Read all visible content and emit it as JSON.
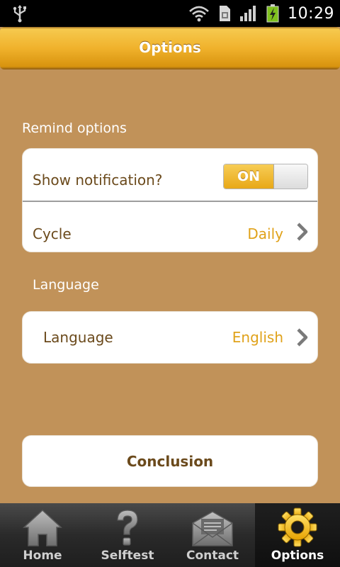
{
  "status_bar": {
    "time": "10:29",
    "icons": [
      "usb-icon",
      "wifi-icon",
      "sim-icon",
      "signal-icon",
      "battery-charging-icon"
    ]
  },
  "header": {
    "title": "Options"
  },
  "remind_section": {
    "label": "Remind options",
    "notification": {
      "label": "Show notification?",
      "toggle_label": "ON",
      "state": "on"
    },
    "cycle": {
      "label": "Cycle",
      "value": "Daily"
    }
  },
  "language_section": {
    "label": "Language",
    "language": {
      "label": "Language",
      "value": "English"
    }
  },
  "conclusion_label": "Conclusion",
  "tabs": [
    {
      "label": "Home",
      "icon": "home-icon",
      "active": false
    },
    {
      "label": "Selftest",
      "icon": "question-icon",
      "active": false
    },
    {
      "label": "Contact",
      "icon": "envelope-icon",
      "active": false
    },
    {
      "label": "Options",
      "icon": "gear-icon",
      "active": true
    }
  ],
  "colors": {
    "background": "#c19259",
    "accent": "#e0a21a",
    "label_text": "#6b4a1c"
  }
}
